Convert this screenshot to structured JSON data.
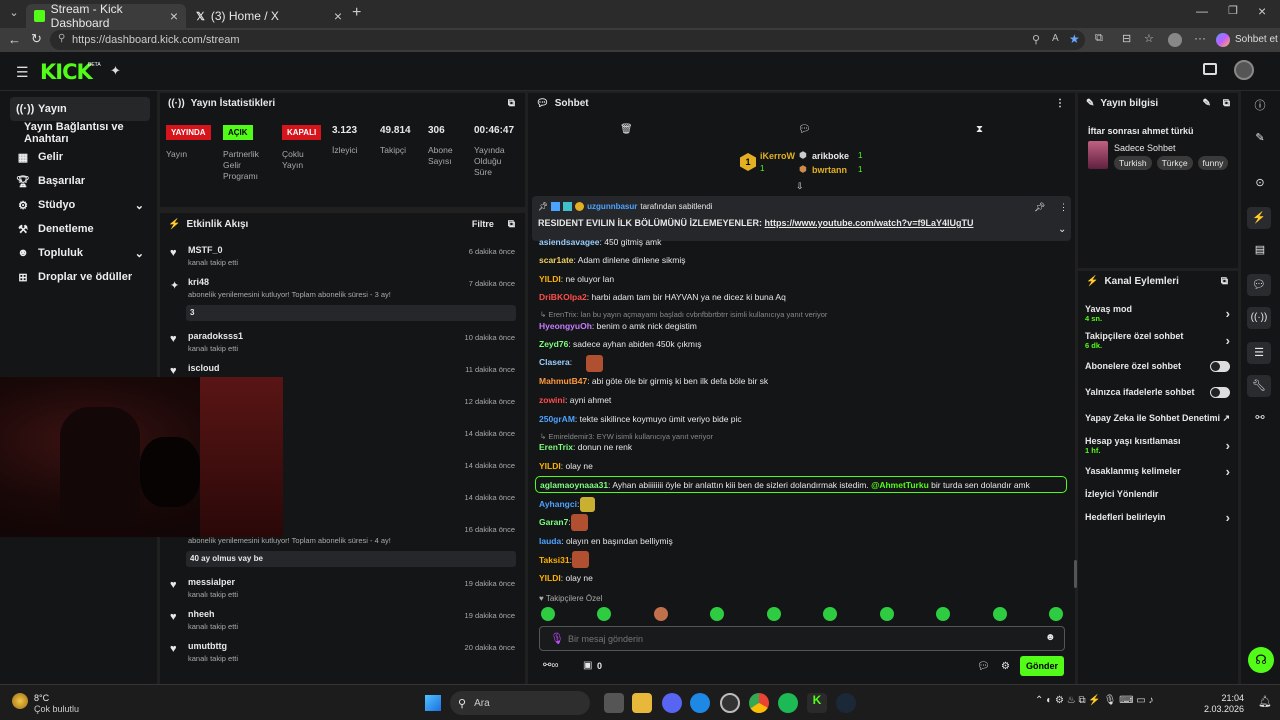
{
  "browser": {
    "tabs": [
      {
        "title": "Stream - Kick Dashboard"
      },
      {
        "title": "(3) Home / X"
      }
    ],
    "url": "https://dashboard.kick.com/stream",
    "profile_label": "Sohbet et"
  },
  "brand": {
    "logo": "KICK",
    "beta": "BETA",
    "accent": "#53fc18"
  },
  "sidebar": {
    "items": [
      {
        "label": "Yayın",
        "icon": "broadcast-icon"
      },
      {
        "label": "Yayın Bağlantısı ve Anahtarı",
        "icon": ""
      },
      {
        "label": "Gelir",
        "icon": "revenue-icon"
      },
      {
        "label": "Başarılar",
        "icon": "trophy-icon"
      },
      {
        "label": "Stüdyo",
        "icon": "studio-icon"
      },
      {
        "label": "Denetleme",
        "icon": "moderation-icon"
      },
      {
        "label": "Topluluk",
        "icon": "community-icon"
      },
      {
        "label": "Droplar ve ödüller",
        "icon": "drops-icon"
      }
    ]
  },
  "stats": {
    "title": "Yayın İstatistikleri",
    "badges": [
      {
        "value": "YAYINDA",
        "label": "Yayın",
        "color": "#d6141c"
      },
      {
        "value": "AÇIK",
        "label": "Partnerlik Gelir Programı",
        "color": "#53fc18"
      },
      {
        "value": "KAPALI",
        "label": "Çoklu Yayın",
        "color": "#d6141c"
      }
    ],
    "numbers": [
      {
        "value": "3.123",
        "label": "İzleyici"
      },
      {
        "value": "49.814",
        "label": "Takipçi"
      },
      {
        "value": "306",
        "label": "Abone Sayısı"
      },
      {
        "value": "00:46:47",
        "label": "Yayında Olduğu Süre"
      }
    ]
  },
  "activity": {
    "title": "Etkinlik Akışı",
    "filter": "Filtre",
    "events": [
      {
        "name": "MSTF_0",
        "sub": "kanalı takip etti",
        "time": "6 dakika önce"
      },
      {
        "name": "kri48",
        "sub": "abonelik yenilemesini kutluyor! Toplam abonelik süresi - 3 ay!",
        "time": "7 dakika önce",
        "note": "3"
      },
      {
        "name": "paradoksss1",
        "sub": "kanalı takip etti",
        "time": "10 dakika önce"
      },
      {
        "name": "iscloud",
        "sub": "",
        "time": "11 dakika önce"
      },
      {
        "name": "",
        "sub": "a abonelik hediye etti.",
        "time": "12 dakika önce"
      },
      {
        "name": "",
        "sub": "abonelik hediye etti.",
        "time": "14 dakika önce"
      },
      {
        "name": "",
        "sub": "abonelik hediye etti.",
        "time": "14 dakika önce"
      },
      {
        "name": "",
        "sub": "",
        "time": "14 dakika önce"
      },
      {
        "name": "",
        "sub": "abonelik yenilemesini kutluyor! Toplam abonelik süresi - 4 ay!",
        "time": "16 dakika önce",
        "note": "40 ay olmus vay be"
      },
      {
        "name": "messialper",
        "sub": "kanalı takip etti",
        "time": "19 dakika önce"
      },
      {
        "name": "nheeh",
        "sub": "kanalı takip etti",
        "time": "19 dakika önce"
      },
      {
        "name": "umutbttg",
        "sub": "kanalı takip etti",
        "time": "20 dakika önce"
      }
    ]
  },
  "chat": {
    "title": "Sohbet",
    "top_users": [
      {
        "name": "iKerroW",
        "count": "1"
      },
      {
        "name": "arikboke",
        "count": "1"
      },
      {
        "name": "bwrtann",
        "count": "1"
      }
    ],
    "pinned": {
      "by": "uzgunnbasur",
      "by_suffix": "tarafından sabitlendi",
      "text": "RESIDENT EVILIN İLK BÖLÜMÜNÜ İZLEMEYENLER: ",
      "link": "https://www.youtube.com/watch?v=f9LaY4lUgTU"
    },
    "messages": [
      {
        "user": "asiendsavagee",
        "text": "450 gitmiş amk",
        "color": "#9ad0ff"
      },
      {
        "user": "scar1ate",
        "text": "Adam dinlene dinlene sikmiş",
        "color": "#f0d060"
      },
      {
        "user": "YILDI",
        "text": "ne oluyor lan",
        "color": "#ffb000"
      },
      {
        "user": "DriBKOlpa2",
        "text": "harbi adam tam bir HAYVAN ya ne dicez ki buna Aq",
        "color": "#ff4d4d"
      },
      {
        "reply": "ErenTrix: lan bu yayın açmayamı başladı cvbnfbbrtbtrr isimli kullanıcıya yanıt veriyor"
      },
      {
        "user": "HyeongyuOh",
        "text": "benim o amk nick degistim",
        "color": "#c77dff"
      },
      {
        "user": "Zeyd76",
        "text": "sadece ayhan abiden 450k çıkmış",
        "color": "#7dff7d"
      },
      {
        "user": "Clasera",
        "text": "",
        "color": "#9ad0ff"
      },
      {
        "user": "MahmutB47",
        "text": "abi göte öle bir girmiş ki ben ilk defa böle bir sk",
        "color": "#ff9a3c"
      },
      {
        "user": "zowini",
        "text": "ayni ahmet",
        "color": "#ff4d4d"
      },
      {
        "user": "250grAM",
        "text": "tekte sikilince koymuyo ümit veriyo bide pic",
        "color": "#4da3ff"
      },
      {
        "reply": "Emireldemir3: EYW isimli kullanıcıya yanıt veriyor"
      },
      {
        "user": "ErenTrix",
        "text": "donun ne renk",
        "color": "#7dff7d"
      },
      {
        "user": "YILDI",
        "text": "olay ne",
        "color": "#ffb000"
      },
      {
        "user": "aglamaoynaaa31",
        "text": "Ayhan abiiiiiiii öyle bir anlattın kiii ben de sizleri dolandırmak istedim. ",
        "mention": "@AhmetTurku",
        "tail": " bir turda sen dolandır amk",
        "color": "#7dff7d",
        "highlight": true
      },
      {
        "user": "Ayhangci",
        "text": "",
        "color": "#4da3ff"
      },
      {
        "user": "Garan7",
        "text": "",
        "color": "#7dff7d"
      },
      {
        "user": "lauda",
        "text": "olayın en başından belliymiş",
        "color": "#4da3ff"
      },
      {
        "user": "Taksi31",
        "text": "",
        "color": "#ffb000"
      },
      {
        "user": "YILDI",
        "text": "olay ne",
        "color": "#ffb000"
      }
    ],
    "followers_only": "Takipçilere Özel",
    "input_placeholder": "Bir mesaj gönderin",
    "counter": "0",
    "send": "Gönder"
  },
  "stream_info": {
    "title": "Yayın bilgisi",
    "stream_title": "İftar sonrası ahmet türkü",
    "category": "Sadece Sohbet",
    "tags": [
      "Turkish",
      "Türkçe",
      "funny"
    ]
  },
  "channel_actions": {
    "title": "Kanal Eylemleri",
    "items": [
      {
        "label": "Yavaş mod",
        "sub": "4 sn.",
        "type": "chevron"
      },
      {
        "label": "Takipçilere özel sohbet",
        "sub": "6 dk.",
        "type": "chevron"
      },
      {
        "label": "Abonelere özel sohbet",
        "sub": "",
        "type": "toggle"
      },
      {
        "label": "Yalnızca ifadelerle sohbet",
        "sub": "",
        "type": "toggle"
      },
      {
        "label": "Yapay Zeka ile Sohbet Denetimi",
        "sub": "",
        "type": "external"
      },
      {
        "label": "Hesap yaşı kısıtlaması",
        "sub": "1 hf.",
        "type": "chevron"
      },
      {
        "label": "Yasaklanmış kelimeler",
        "sub": "",
        "type": "chevron"
      },
      {
        "label": "İzleyici Yönlendir",
        "sub": "",
        "type": "none"
      },
      {
        "label": "Hedefleri belirleyin",
        "sub": "",
        "type": "chevron"
      }
    ]
  },
  "taskbar": {
    "weather_temp": "8°C",
    "weather_text": "Çok bulutlu",
    "search": "Ara",
    "time": "21:04",
    "date": "2.03.2026"
  }
}
